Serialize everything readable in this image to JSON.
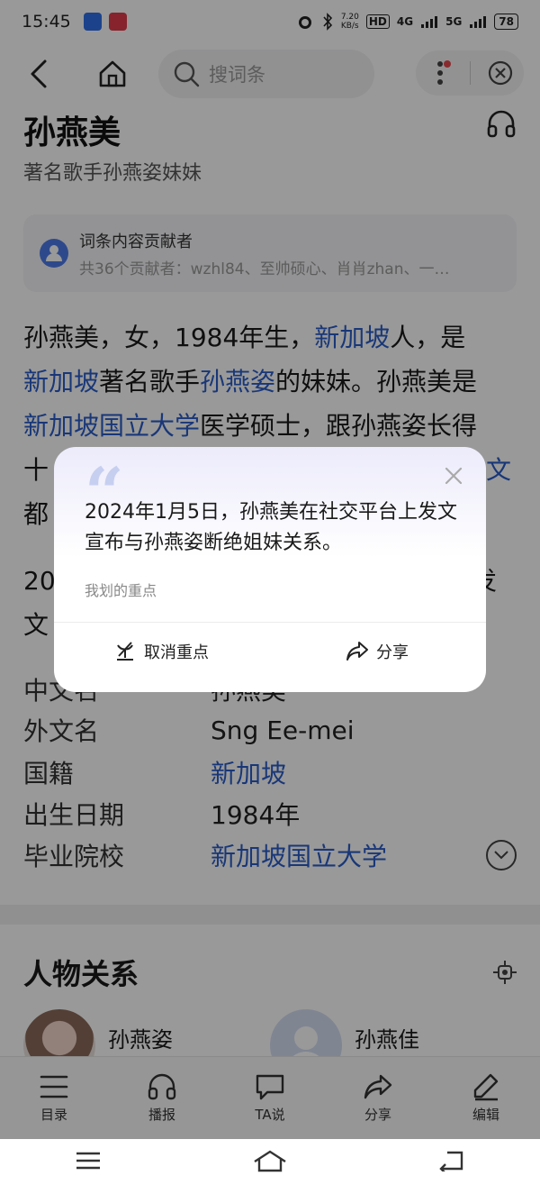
{
  "status_bar": {
    "time": "15:45",
    "net_speed_value": "7.20",
    "net_speed_unit": "KB/s",
    "hd": "HD",
    "sig_4g": "4G",
    "sig_5g": "5G",
    "battery": "78"
  },
  "nav": {
    "search_placeholder": "搜词条"
  },
  "entry": {
    "title": "孙燕美",
    "subtitle": "著名歌手孙燕姿妹妹",
    "contributors_title": "词条内容贡献者",
    "contributors_list": "共36个贡献者：wzhl84、至帅硕心、肖肖zhan、一…"
  },
  "paragraph1": {
    "l1a": "孙燕美，女，1984年生，",
    "l1link": "新加坡",
    "l1b": "人，是",
    "l2link": "新加坡",
    "l2a": "著名歌手",
    "l2link2": "孙燕姿",
    "l2b": "的妹妹。孙燕美是",
    "l3link": "新加坡国立大学",
    "l3a": "医学硕士，跟孙燕姿长得",
    "l4a": "十",
    "l4link": "文",
    "l5a": "都"
  },
  "paragraph2": {
    "l1a": "20",
    "l1b": "发",
    "l2a": "文"
  },
  "infobox": [
    {
      "label": "中文名",
      "value": "孙燕美",
      "is_link": false
    },
    {
      "label": "外文名",
      "value": "Sng Ee-mei",
      "is_link": false
    },
    {
      "label": "国籍",
      "value": "新加坡",
      "is_link": true
    },
    {
      "label": "出生日期",
      "value": "1984年",
      "is_link": false
    },
    {
      "label": "毕业院校",
      "value": "新加坡国立大学",
      "is_link": true
    }
  ],
  "relations": {
    "title": "人物关系",
    "people": [
      {
        "name": "孙燕姿"
      },
      {
        "name": "孙燕佳"
      }
    ]
  },
  "toolbar": [
    {
      "label": "目录",
      "icon": "list-icon"
    },
    {
      "label": "播报",
      "icon": "headphones-icon"
    },
    {
      "label": "TA说",
      "icon": "speech-bubble-icon"
    },
    {
      "label": "分享",
      "icon": "share-icon"
    },
    {
      "label": "编辑",
      "icon": "edit-pen-icon"
    }
  ],
  "popup": {
    "quote_mark": "“",
    "text": "2024年1月5日，孙燕美在社交平台上发文宣布与孙燕姿断绝姐妹关系。",
    "caption": "我划的重点",
    "cancel_label": "取消重点",
    "share_label": "分享"
  },
  "colors": {
    "link": "#2a5dc8",
    "overlay": "rgba(0,0,0,0.40)"
  }
}
